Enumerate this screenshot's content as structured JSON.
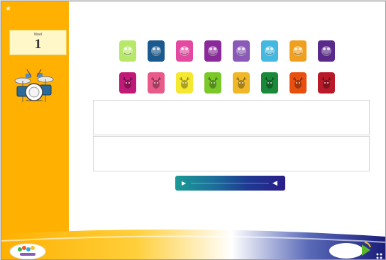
{
  "app": {
    "accent_color": "#ffb000",
    "sidebar_color": "#ffb000",
    "panel_border_color": "#d6d6d6"
  },
  "sidebar": {
    "level_label": "Nivel",
    "level_value": "1",
    "star_icon": "star-icon",
    "drum_icon": "drum-kit-icon"
  },
  "tiles_row1": [
    {
      "color": "#b8e86a",
      "icon": "frog-icon"
    },
    {
      "color": "#1a5a8e",
      "icon": "frog-icon"
    },
    {
      "color": "#e14aa0",
      "icon": "frog-icon"
    },
    {
      "color": "#8a2a9a",
      "icon": "frog-icon"
    },
    {
      "color": "#8a5ab8",
      "icon": "frog-icon"
    },
    {
      "color": "#44b8e0",
      "icon": "frog-icon"
    },
    {
      "color": "#f0a020",
      "icon": "frog-icon"
    },
    {
      "color": "#5a2a8a",
      "icon": "frog-icon"
    }
  ],
  "tiles_row2": [
    {
      "color": "#c01a78",
      "icon": "deer-icon"
    },
    {
      "color": "#e85a8a",
      "icon": "deer-icon"
    },
    {
      "color": "#f4e830",
      "icon": "deer-icon"
    },
    {
      "color": "#7ac82a",
      "icon": "deer-icon"
    },
    {
      "color": "#f0b828",
      "icon": "deer-icon"
    },
    {
      "color": "#1a8a3a",
      "icon": "deer-icon"
    },
    {
      "color": "#e85010",
      "icon": "deer-icon"
    },
    {
      "color": "#b81a2a",
      "icon": "deer-icon"
    }
  ],
  "player": {
    "play_icon": "play-icon",
    "volume_icon": "volume-icon",
    "progress_fraction": 0
  },
  "footer": {
    "logo_icon": "brand-logo-icon",
    "next_icon": "next-arrow-icon"
  }
}
